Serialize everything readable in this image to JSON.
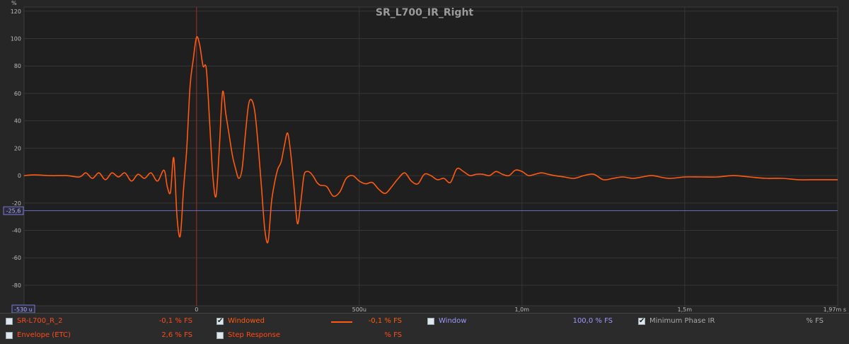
{
  "chart_data": {
    "type": "line",
    "title": "SR_L700_IR_Right",
    "ylabel": "%",
    "xunit": "s",
    "ylim": [
      -95,
      123
    ],
    "xlim": [
      -0.00053,
      0.00197
    ],
    "yticks": [
      120,
      100,
      80,
      60,
      40,
      20,
      0,
      -20,
      -40,
      -60,
      -80
    ],
    "ytick_labels": [
      "120",
      "100",
      "80",
      "60",
      "40",
      "20",
      "0",
      "-20",
      "-40",
      "-60",
      "-80"
    ],
    "xticks": [
      0,
      0.0005,
      0.001,
      0.0015
    ],
    "xtick_labels": [
      "0",
      "500u",
      "1,0m",
      "1,5m"
    ],
    "x_start_label": "-530 u",
    "x_end_label": "1,97m s",
    "cursor_y": -25.6,
    "cursor_y_label": "-25,6",
    "cursor_x": 0,
    "grid": true,
    "series": [
      {
        "color": "#ff5a10",
        "x": [
          -0.00053,
          -0.0005,
          -0.00045,
          -0.0004,
          -0.00036,
          -0.00034,
          -0.00032,
          -0.0003,
          -0.00028,
          -0.00026,
          -0.00024,
          -0.00022,
          -0.0002,
          -0.00018,
          -0.00016,
          -0.00014,
          -0.00012,
          -0.0001,
          -9e-05,
          -8e-05,
          -7e-05,
          -6e-05,
          -5e-05,
          -4e-05,
          -3e-05,
          -2e-05,
          -1e-05,
          0,
          1e-05,
          2e-05,
          3e-05,
          4e-05,
          5e-05,
          6e-05,
          7e-05,
          8e-05,
          9e-05,
          0.0001,
          0.00011,
          0.00012,
          0.00013,
          0.00014,
          0.00015,
          0.00016,
          0.00017,
          0.00018,
          0.00019,
          0.0002,
          0.00021,
          0.00022,
          0.00023,
          0.00024,
          0.00025,
          0.00026,
          0.00027,
          0.00028,
          0.00029,
          0.0003,
          0.00031,
          0.00032,
          0.00033,
          0.00034,
          0.00035,
          0.00036,
          0.00037,
          0.00038,
          0.0004,
          0.00042,
          0.00044,
          0.00046,
          0.00048,
          0.0005,
          0.00052,
          0.00054,
          0.00056,
          0.00058,
          0.0006,
          0.00062,
          0.00064,
          0.00066,
          0.00068,
          0.0007,
          0.00072,
          0.00074,
          0.00076,
          0.00078,
          0.0008,
          0.00082,
          0.00084,
          0.00086,
          0.00088,
          0.0009,
          0.00092,
          0.00094,
          0.00096,
          0.00098,
          0.001,
          0.00102,
          0.00104,
          0.00106,
          0.00108,
          0.0011,
          0.00113,
          0.00116,
          0.00119,
          0.00122,
          0.00125,
          0.00128,
          0.00131,
          0.00134,
          0.00137,
          0.0014,
          0.00145,
          0.0015,
          0.00155,
          0.0016,
          0.00165,
          0.0017,
          0.00175,
          0.0018,
          0.00185,
          0.0019,
          0.00197
        ],
        "y": [
          0,
          0.5,
          0,
          0,
          -1,
          2,
          -2,
          2,
          -3,
          2,
          -1,
          2,
          -4,
          1,
          -2,
          2,
          -4,
          4,
          -8,
          -12,
          13,
          -30,
          -44,
          -10,
          20,
          65,
          85,
          101,
          95,
          80,
          78,
          40,
          0,
          -15,
          20,
          61,
          45,
          30,
          15,
          5,
          -2,
          5,
          30,
          52,
          55,
          45,
          20,
          -10,
          -40,
          -48,
          -20,
          -5,
          5,
          10,
          22,
          31,
          15,
          -10,
          -35,
          -20,
          0,
          3,
          2,
          -1,
          -5,
          -7,
          -8,
          -15,
          -12,
          -2,
          0,
          -4,
          -6,
          -5,
          -10,
          -13,
          -8,
          -2,
          2,
          -4,
          -6,
          1,
          0,
          -3,
          -2,
          -5,
          5,
          3,
          0,
          1,
          1,
          0,
          3,
          1,
          0,
          4,
          3,
          0,
          1,
          2,
          1,
          0,
          -1,
          -2,
          0,
          1,
          -3,
          -2,
          -1,
          -2,
          -1,
          0,
          -2,
          -1,
          -1,
          -1,
          0,
          -1,
          -2,
          -2,
          -3,
          -3,
          -3
        ]
      }
    ]
  },
  "legend": {
    "row1": {
      "item1_label": "SR-L700_R_2",
      "item1_value": "-0,1 % FS",
      "item2_label": "Windowed",
      "item2_value": "-0,1 % FS",
      "item3_label": "Window",
      "item3_value": "100,0 % FS",
      "item4_label": "Minimum Phase IR",
      "item4_value": "% FS"
    },
    "row2": {
      "item1_label": "Envelope (ETC)",
      "item1_value": "2,6 % FS",
      "item2_label": "Step Response",
      "item2_value": "% FS"
    },
    "colors": {
      "red": "#ff4a1a",
      "orange": "#ff5a10",
      "blue": "#9a9aff",
      "gray": "#aaaaaa"
    }
  }
}
